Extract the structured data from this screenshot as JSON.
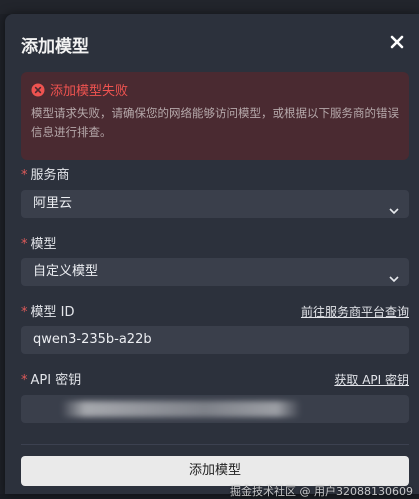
{
  "modal": {
    "title": "添加模型",
    "close_icon": "close-icon"
  },
  "alert": {
    "icon": "error-circle-icon",
    "title": "添加模型失败",
    "message": "模型请求失败，请确保您的网络能够访问模型，或根据以下服务商的错误信息进行排查。"
  },
  "form": {
    "provider": {
      "label": "服务商",
      "value": "阿里云"
    },
    "model": {
      "label": "模型",
      "value": "自定义模型"
    },
    "model_id": {
      "label": "模型 ID",
      "value": "qwen3-235b-a22b",
      "link": "前往服务商平台查询"
    },
    "api_key": {
      "label": "API 密钥",
      "link": "获取 API 密钥"
    },
    "required_mark": "*"
  },
  "submit_label": "添加模型",
  "watermark": "掘金技术社区 @ 用户32088130609",
  "colors": {
    "modal_bg": "#2c313c",
    "alert_bg": "#4a2a31",
    "error": "#ef5350",
    "field_bg": "#3a3f4b"
  }
}
